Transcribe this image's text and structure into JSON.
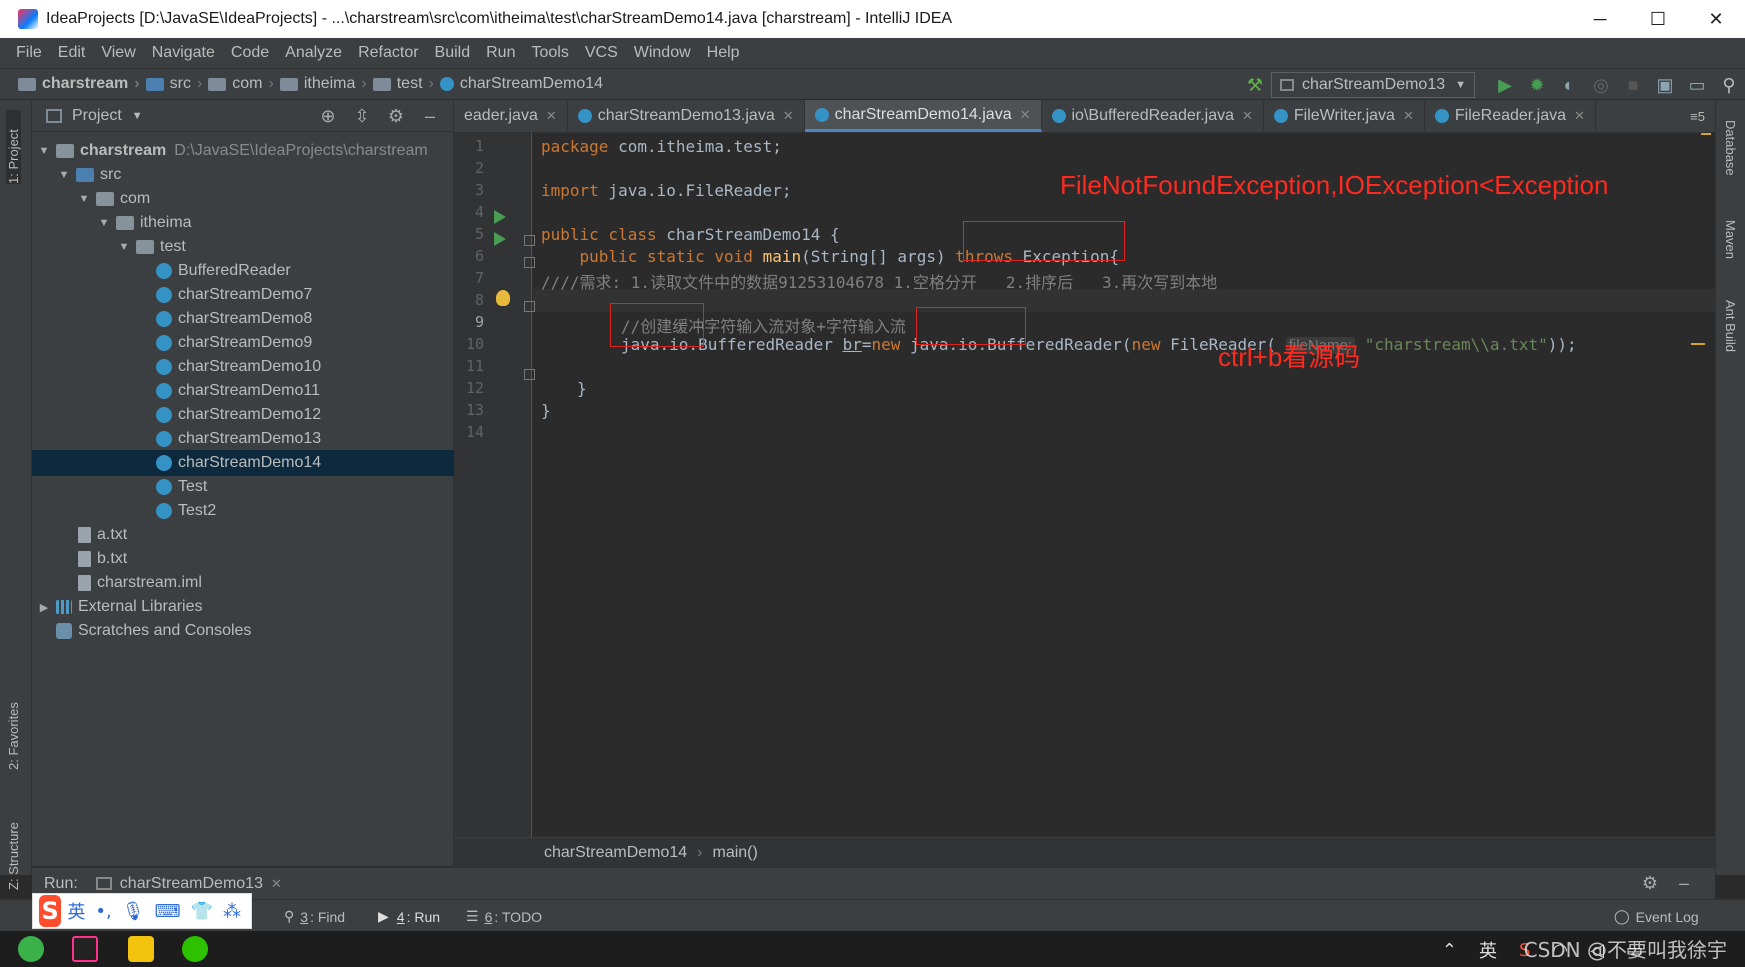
{
  "window": {
    "title": "IdeaProjects [D:\\JavaSE\\IdeaProjects] - ...\\charstream\\src\\com\\itheima\\test\\charStreamDemo14.java [charstream] - IntelliJ IDEA",
    "minimize": "─",
    "maximize": "☐",
    "close": "✕"
  },
  "menu": [
    "File",
    "Edit",
    "View",
    "Navigate",
    "Code",
    "Analyze",
    "Refactor",
    "Build",
    "Run",
    "Tools",
    "VCS",
    "Window",
    "Help"
  ],
  "navbar": {
    "crumbs": [
      "charstream",
      "src",
      "com",
      "itheima",
      "test",
      "charStreamDemo14"
    ],
    "run_config": "charStreamDemo13"
  },
  "left_strip": {
    "project": "1: Project",
    "favorites": "2: Favorites",
    "structure": "Z: Structure"
  },
  "right_strip": {
    "database": "Database",
    "maven": "Maven",
    "ant": "Ant Build"
  },
  "project_panel": {
    "title": "Project",
    "root_name": "charstream",
    "root_path": "D:\\JavaSE\\IdeaProjects\\charstream",
    "src": "src",
    "com": "com",
    "itheima": "itheima",
    "test": "test",
    "classes": [
      "BufferedReader",
      "charStreamDemo7",
      "charStreamDemo8",
      "charStreamDemo9",
      "charStreamDemo10",
      "charStreamDemo11",
      "charStreamDemo12",
      "charStreamDemo13",
      "charStreamDemo14",
      "Test",
      "Test2"
    ],
    "files": [
      "a.txt",
      "b.txt",
      "charstream.iml"
    ],
    "external": "External Libraries",
    "scratches": "Scratches and Consoles"
  },
  "tabs": [
    {
      "label": "eader.java",
      "active": false
    },
    {
      "label": "charStreamDemo13.java",
      "active": false
    },
    {
      "label": "charStreamDemo14.java",
      "active": true
    },
    {
      "label": "io\\BufferedReader.java",
      "active": false
    },
    {
      "label": "FileWriter.java",
      "active": false
    },
    {
      "label": "FileReader.java",
      "active": false
    }
  ],
  "tabs_overflow": "5",
  "line_numbers": [
    "1",
    "2",
    "3",
    "4",
    "5",
    "6",
    "7",
    "8",
    "9",
    "10",
    "11",
    "12",
    "13",
    "14"
  ],
  "code": {
    "l1_kw": "package",
    "l1_rest": " com.itheima.test;",
    "l3_kw": "import",
    "l3_rest": " java.io.FileReader;",
    "l5_kw": "public class",
    "l5_rest": " charStreamDemo14 {",
    "l6_kw": "public static void",
    "l6_fn": "main",
    "l6_args": "(String[] args) ",
    "l6_throws": "throws",
    "l6_exc": " Exception{",
    "l7_comment": "////需求: 1.读取文件中的数据91253104678 1.空格分开   2.排序后   3.再次写到本地",
    "l9_comment": "//创建缓冲字符输入流对象+字符输入流",
    "l10_type": "java.io.BufferedReader ",
    "l10_var": "br",
    "l10_eq": "=",
    "l10_new": "new",
    "l10_ctor": " java.io.BufferedReader(",
    "l10_new2": "new",
    "l10_fr": " FileReader(",
    "l10_hint": "fileName:",
    "l10_str": "\"charstream\\\\a.txt\"",
    "l10_end": "));",
    "l12": "}",
    "l13": "}"
  },
  "annotations": {
    "exceptions": "FileNotFoundException,IOException<Exception",
    "ctrl_b": "ctrl+b看源码"
  },
  "editor_breadcrumb": [
    "charStreamDemo14",
    "main()"
  ],
  "run_bar": {
    "label": "Run:",
    "tab": "charStreamDemo13"
  },
  "status_tools": [
    {
      "num": "3",
      "label": ": Find"
    },
    {
      "num": "4",
      "label": ": Run"
    },
    {
      "num": "6",
      "label": ": TODO"
    }
  ],
  "event_log": "Event Log",
  "ime": {
    "lang": "英",
    "punct": "•,"
  },
  "tray": {
    "lang": "英"
  },
  "watermark": "CSDN @不要叫我徐宇",
  "colors": {
    "accent": "#4a88c7",
    "annotation_red": "#ff2a1f",
    "keyword": "#cc7832",
    "string": "#6a8759",
    "comment": "#808080"
  }
}
